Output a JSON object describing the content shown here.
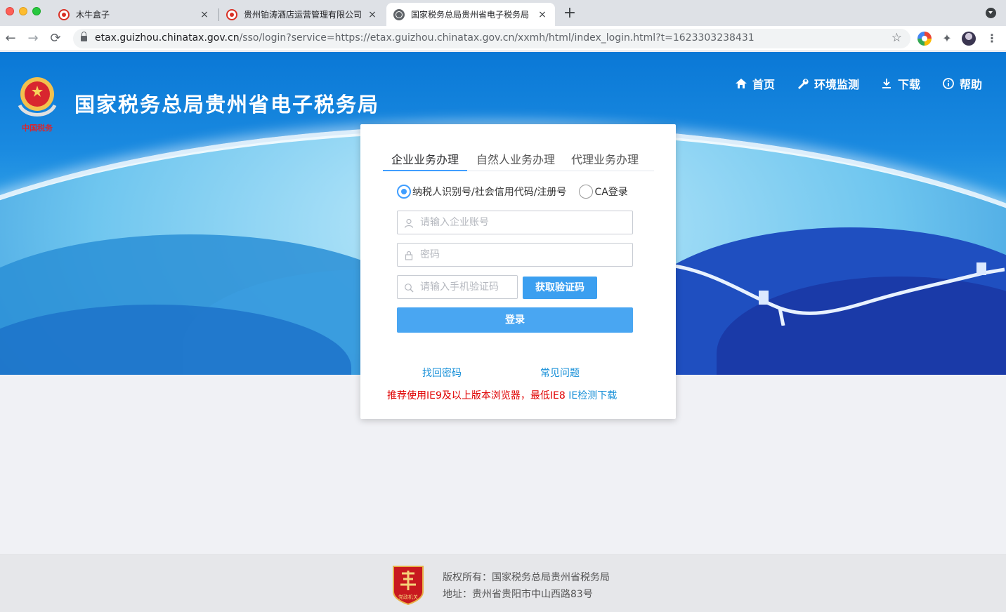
{
  "browser": {
    "tabs": [
      {
        "title": "木牛盒子",
        "close": "×"
      },
      {
        "title": "贵州铂涛酒店运营管理有限公司",
        "close": "×"
      },
      {
        "title": "国家税务总局贵州省电子税务局",
        "close": "×"
      }
    ],
    "new_tab": "+",
    "url_host": "etax.guizhou.chinatax.gov.cn",
    "url_path": "/sso/login?service=https://etax.guizhou.chinatax.gov.cn/xxmh/html/index_login.html?t=1623303238431",
    "nav": {
      "back": "←",
      "forward": "→",
      "reload": "⟳",
      "star": "☆",
      "puzzle": "✦",
      "menu": "⋮"
    }
  },
  "header": {
    "title": "国家税务总局贵州省电子税务局",
    "emblem_caption": "中国税务",
    "nav": [
      {
        "label": "首页",
        "icon": "home-icon"
      },
      {
        "label": "环境监测",
        "icon": "wrench-icon"
      },
      {
        "label": "下载",
        "icon": "download-icon"
      },
      {
        "label": "帮助",
        "icon": "info-icon"
      }
    ]
  },
  "login": {
    "tabs": [
      "企业业务办理",
      "自然人业务办理",
      "代理业务办理"
    ],
    "active_tab": 0,
    "radio_options": [
      "纳税人识别号/社会信用代码/注册号",
      "CA登录"
    ],
    "account_placeholder": "请输入企业账号",
    "password_placeholder": "密码",
    "sms_placeholder": "请输入手机验证码",
    "get_code_label": "获取验证码",
    "submit_label": "登录",
    "link_reset": "找回密码",
    "link_faq": "常见问题",
    "notice": "推荐使用IE9及以上版本浏览器，最低IE8",
    "notice_link": "IE检测下载"
  },
  "footer": {
    "copyright": "版权所有：国家税务总局贵州省税务局",
    "address": "地址：贵州省贵阳市中山西路83号",
    "badge_text": "党政机关"
  },
  "colors": {
    "primary": "#409eff",
    "button": "#49a6f2",
    "warning": "#e00000",
    "link": "#1890d8",
    "banner": "#1a8ae0"
  }
}
